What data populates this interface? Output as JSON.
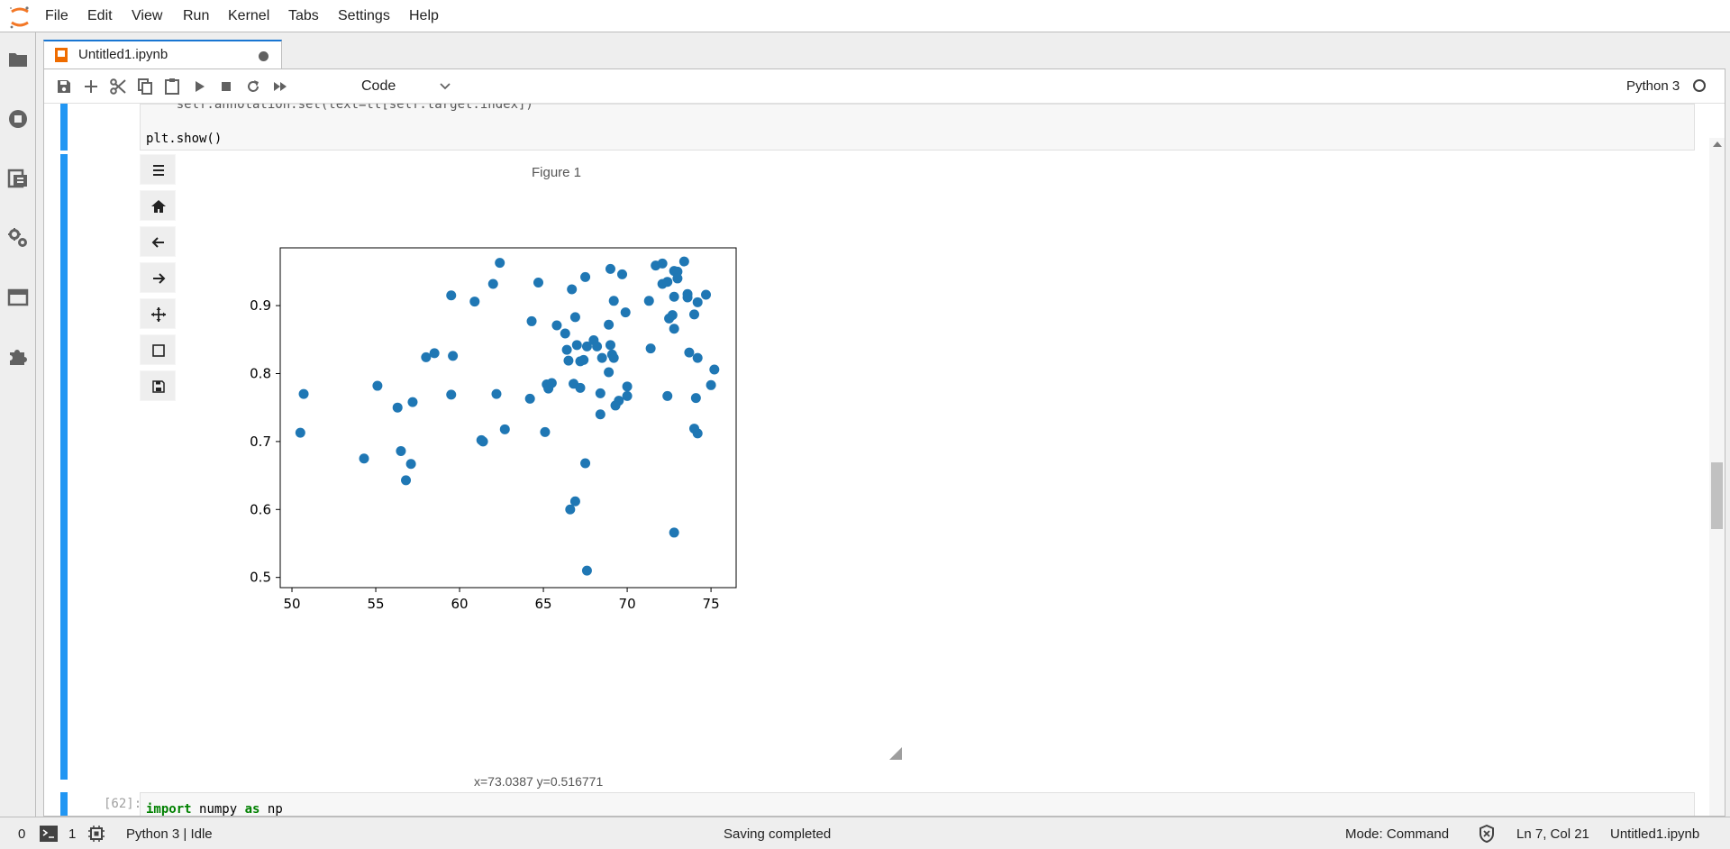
{
  "menubar": {
    "items": [
      "File",
      "Edit",
      "View",
      "Run",
      "Kernel",
      "Tabs",
      "Settings",
      "Help"
    ]
  },
  "sidebar": {
    "icons": [
      "folder-icon",
      "running-icon",
      "commands-icon",
      "property-inspector-icon",
      "tabs-icon",
      "extensions-icon"
    ]
  },
  "tab": {
    "label": "Untitled1.ipynb"
  },
  "toolbar": {
    "cell_type": "Code",
    "kernel_name": "Python 3"
  },
  "cells": {
    "cell1_partial_line": "    self.annotation.set(text=tt[self.target.index])",
    "cell1_last_line": "plt.show()",
    "cell2_prompt": "[62]:",
    "cell2_code_keyword1": "import",
    "cell2_code_module": "numpy",
    "cell2_code_keyword2": "as",
    "cell2_code_alias": "np"
  },
  "figure": {
    "title": "Figure 1",
    "coord_readout": "x=73.0387 y=0.516771"
  },
  "chart_data": {
    "type": "scatter",
    "title": "",
    "xlabel": "",
    "ylabel": "",
    "xlim": [
      49.3,
      76.5
    ],
    "ylim": [
      0.485,
      0.985
    ],
    "xticks": [
      "50",
      "55",
      "60",
      "65",
      "70",
      "75"
    ],
    "yticks": [
      "0.5",
      "0.6",
      "0.7",
      "0.8",
      "0.9"
    ],
    "marker_color": "#1f77b4",
    "points": [
      [
        50.5,
        0.713
      ],
      [
        50.7,
        0.77
      ],
      [
        54.3,
        0.675
      ],
      [
        55.1,
        0.782
      ],
      [
        56.3,
        0.75
      ],
      [
        56.5,
        0.686
      ],
      [
        56.8,
        0.643
      ],
      [
        57.1,
        0.667
      ],
      [
        57.2,
        0.758
      ],
      [
        58.0,
        0.824
      ],
      [
        58.5,
        0.83
      ],
      [
        59.5,
        0.915
      ],
      [
        59.5,
        0.769
      ],
      [
        59.6,
        0.826
      ],
      [
        60.9,
        0.906
      ],
      [
        61.3,
        0.702
      ],
      [
        61.4,
        0.7
      ],
      [
        62.0,
        0.932
      ],
      [
        62.2,
        0.77
      ],
      [
        62.4,
        0.963
      ],
      [
        62.7,
        0.718
      ],
      [
        64.2,
        0.763
      ],
      [
        64.3,
        0.877
      ],
      [
        64.7,
        0.934
      ],
      [
        65.1,
        0.714
      ],
      [
        65.2,
        0.784
      ],
      [
        65.3,
        0.778
      ],
      [
        65.5,
        0.786
      ],
      [
        65.8,
        0.871
      ],
      [
        66.3,
        0.859
      ],
      [
        66.4,
        0.835
      ],
      [
        66.5,
        0.819
      ],
      [
        66.6,
        0.6
      ],
      [
        66.7,
        0.924
      ],
      [
        66.8,
        0.785
      ],
      [
        66.9,
        0.612
      ],
      [
        66.9,
        0.883
      ],
      [
        67.0,
        0.842
      ],
      [
        67.2,
        0.818
      ],
      [
        67.2,
        0.779
      ],
      [
        67.4,
        0.82
      ],
      [
        67.5,
        0.942
      ],
      [
        67.5,
        0.668
      ],
      [
        67.6,
        0.84
      ],
      [
        67.6,
        0.51
      ],
      [
        68.0,
        0.849
      ],
      [
        68.2,
        0.84
      ],
      [
        68.4,
        0.771
      ],
      [
        68.4,
        0.74
      ],
      [
        68.5,
        0.823
      ],
      [
        68.9,
        0.802
      ],
      [
        68.9,
        0.872
      ],
      [
        69.0,
        0.954
      ],
      [
        69.0,
        0.842
      ],
      [
        69.1,
        0.828
      ],
      [
        69.2,
        0.823
      ],
      [
        69.2,
        0.907
      ],
      [
        69.3,
        0.753
      ],
      [
        69.5,
        0.76
      ],
      [
        69.7,
        0.946
      ],
      [
        69.9,
        0.89
      ],
      [
        70.0,
        0.781
      ],
      [
        70.0,
        0.767
      ],
      [
        71.3,
        0.907
      ],
      [
        71.4,
        0.837
      ],
      [
        71.7,
        0.959
      ],
      [
        72.1,
        0.962
      ],
      [
        72.1,
        0.932
      ],
      [
        72.4,
        0.767
      ],
      [
        72.4,
        0.935
      ],
      [
        72.5,
        0.881
      ],
      [
        72.7,
        0.886
      ],
      [
        72.8,
        0.866
      ],
      [
        72.8,
        0.913
      ],
      [
        72.8,
        0.951
      ],
      [
        72.8,
        0.566
      ],
      [
        73.0,
        0.95
      ],
      [
        73.0,
        0.94
      ],
      [
        73.4,
        0.965
      ],
      [
        73.6,
        0.917
      ],
      [
        73.6,
        0.912
      ],
      [
        73.7,
        0.831
      ],
      [
        74.0,
        0.887
      ],
      [
        74.0,
        0.719
      ],
      [
        74.1,
        0.764
      ],
      [
        74.2,
        0.905
      ],
      [
        74.2,
        0.823
      ],
      [
        74.2,
        0.712
      ],
      [
        74.7,
        0.916
      ],
      [
        75.0,
        0.783
      ],
      [
        75.2,
        0.806
      ]
    ]
  },
  "statusbar": {
    "count1": "0",
    "count2": "1",
    "kernel_status": "Python 3 | Idle",
    "save_status": "Saving completed",
    "mode": "Mode: Command",
    "cursor": "Ln 7, Col 21",
    "filename": "Untitled1.ipynb"
  }
}
